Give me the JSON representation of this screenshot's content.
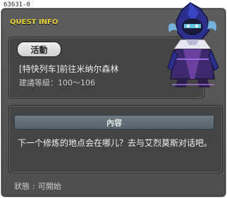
{
  "window": {
    "quest_id": "63631-0",
    "title": "QUEST INFO"
  },
  "quest": {
    "badge": "活動",
    "name": "[特快列车]前往米纳尔森林",
    "level_label": "建議等級",
    "level_range": "100～106"
  },
  "content": {
    "header": "內容",
    "body": "下一个修炼的地点会在哪儿？去与艾烈莫斯对话吧。"
  },
  "status": {
    "label": "狀態",
    "value": "可開始"
  },
  "colors": {
    "title": "#e8d23a",
    "window_bg": "#555555",
    "panel_bg": "#444444",
    "content_header_bg": "#5f6c74"
  },
  "icons": [
    "npc-character-portrait"
  ]
}
